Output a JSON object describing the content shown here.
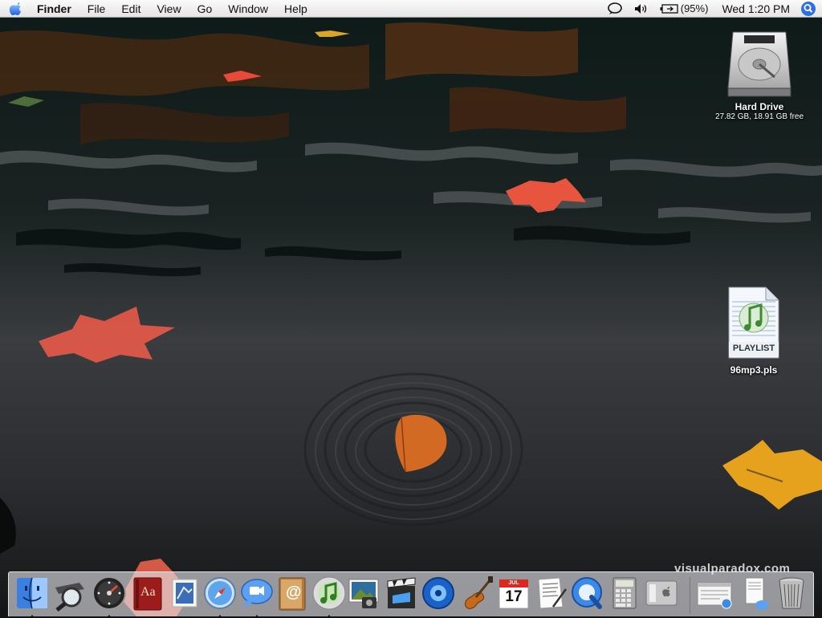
{
  "menubar": {
    "apple_icon": "apple-logo",
    "app_name": "Finder",
    "items": [
      "File",
      "Edit",
      "View",
      "Go",
      "Window",
      "Help"
    ],
    "status": {
      "chat_icon": "ichat-status-icon",
      "volume_icon": "speaker-volume-icon",
      "battery_icon": "battery-charging-icon",
      "battery_percent": "(95%)",
      "clock": "Wed 1:20 PM",
      "spotlight_icon": "spotlight-search-icon"
    }
  },
  "desktop": {
    "icons": [
      {
        "name": "Hard Drive",
        "subtitle": "27.82 GB, 18.91 GB free",
        "icon": "hard-drive-icon"
      },
      {
        "name": "96mp3.pls",
        "icon": "playlist-file-icon",
        "badge": "PLAYLIST"
      }
    ],
    "watermark": "visualparadox.com"
  },
  "dock": {
    "apps": [
      {
        "name": "Finder",
        "icon": "finder-icon",
        "running": true
      },
      {
        "name": "Spotlight",
        "icon": "magnifier-icon",
        "running": false
      },
      {
        "name": "Dashboard",
        "icon": "dashboard-icon",
        "running": true
      },
      {
        "name": "Dictionary",
        "icon": "dictionary-icon",
        "running": false,
        "label": "Aa"
      },
      {
        "name": "Mail",
        "icon": "mail-stamp-icon",
        "running": false
      },
      {
        "name": "Safari",
        "icon": "safari-compass-icon",
        "running": true
      },
      {
        "name": "iChat",
        "icon": "ichat-icon",
        "running": true
      },
      {
        "name": "Address Book",
        "icon": "address-book-icon",
        "running": false,
        "label": "@"
      },
      {
        "name": "iTunes",
        "icon": "itunes-icon",
        "running": true
      },
      {
        "name": "iPhoto",
        "icon": "iphoto-icon",
        "running": false
      },
      {
        "name": "iMovie",
        "icon": "imovie-icon",
        "running": false
      },
      {
        "name": "iDVD",
        "icon": "idvd-icon",
        "running": false
      },
      {
        "name": "GarageBand",
        "icon": "garageband-guitar-icon",
        "running": false
      },
      {
        "name": "iCal",
        "icon": "ical-calendar-icon",
        "running": false,
        "label": "17",
        "month": "JUL"
      },
      {
        "name": "TextEdit",
        "icon": "textedit-icon",
        "running": false
      },
      {
        "name": "QuickTime Player",
        "icon": "quicktime-icon",
        "running": false
      },
      {
        "name": "Calculator",
        "icon": "calculator-icon",
        "running": false
      },
      {
        "name": "System Preferences",
        "icon": "system-preferences-icon",
        "running": false
      }
    ],
    "others": [
      {
        "name": "Minimized Window",
        "icon": "minimized-window-icon"
      },
      {
        "name": "Document Stack",
        "icon": "document-stack-icon"
      },
      {
        "name": "Trash",
        "icon": "trash-icon"
      }
    ]
  }
}
